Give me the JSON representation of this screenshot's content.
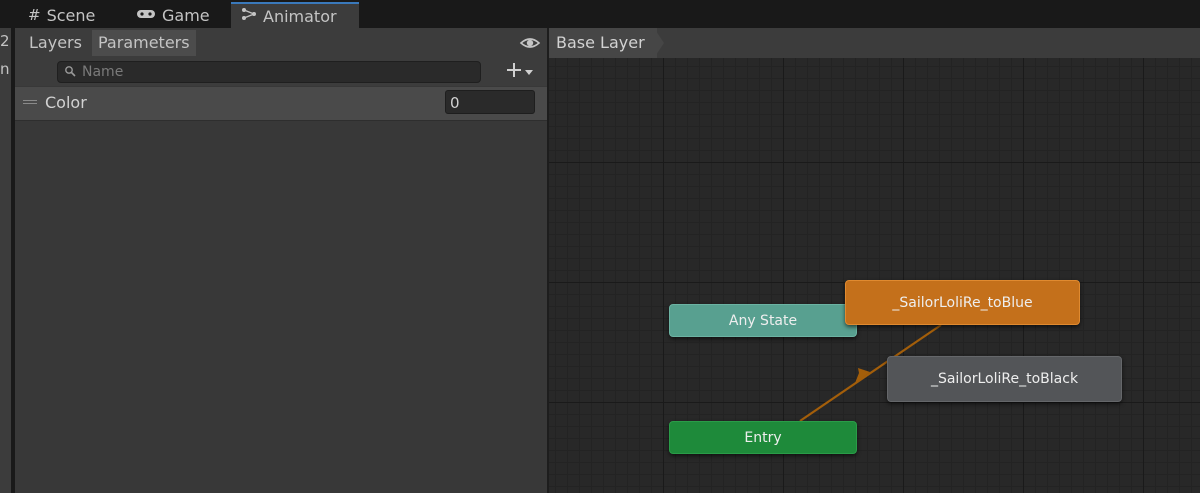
{
  "tabs": [
    {
      "label": "Scene",
      "icon": "grid-icon"
    },
    {
      "label": "Game",
      "icon": "gamepad-icon"
    },
    {
      "label": "Animator",
      "icon": "animator-icon",
      "active": true
    }
  ],
  "sliver": {
    "line1": "2",
    "line2": "n"
  },
  "parameters_panel": {
    "tab_layers": "Layers",
    "tab_parameters": "Parameters",
    "search_placeholder": "Name",
    "add_icon": "plus-icon",
    "visibility_icon": "eye-icon",
    "params": [
      {
        "name": "Color",
        "value": "0"
      }
    ]
  },
  "graph": {
    "breadcrumb": "Base Layer",
    "states": {
      "any_state": "Any State",
      "entry": "Entry",
      "to_blue": "_SailorLoliRe_toBlue",
      "to_black": "_SailorLoliRe_toBlack"
    }
  },
  "colors": {
    "active_tab_accent": "#3a79bb",
    "any_state": "#58a090",
    "entry": "#1e8a3a",
    "default_state": "#c4701b",
    "state": "#535558",
    "transition": "#a35e0a"
  }
}
